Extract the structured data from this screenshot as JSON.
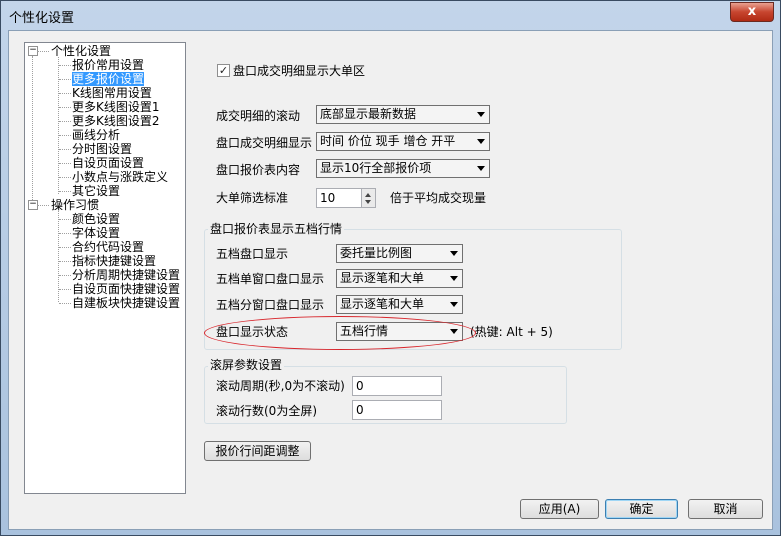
{
  "window": {
    "title": "个性化设置",
    "close_label": "x"
  },
  "tree": {
    "groups": [
      {
        "label": "个性化设置",
        "expander": "−",
        "children": [
          "报价常用设置",
          "更多报价设置",
          "K线图常用设置",
          "更多K线图设置1",
          "更多K线图设置2",
          "画线分析",
          "分时图设置",
          "自设页面设置",
          "小数点与涨跌定义",
          "其它设置"
        ]
      },
      {
        "label": "操作习惯",
        "expander": "−",
        "children": [
          "颜色设置",
          "字体设置",
          "合约代码设置",
          "指标快捷键设置",
          "分析周期快捷键设置",
          "自设页面快捷键设置",
          "自建板块快捷键设置"
        ]
      }
    ],
    "selected": "更多报价设置"
  },
  "settings": {
    "big_order_checkbox": {
      "label": "盘口成交明细显示大单区",
      "checked": true,
      "mark": "✓"
    },
    "scroll": {
      "label": "成交明细的滚动",
      "value": "底部显示最新数据"
    },
    "detail_display": {
      "label": "盘口成交明细显示",
      "value": "时间 价位 现手 增仓 开平"
    },
    "quote_content": {
      "label": "盘口报价表内容",
      "value": "显示10行全部报价项"
    },
    "big_filter": {
      "label": "大单筛选标准",
      "value": "10",
      "suffix": "倍于平均成交现量"
    }
  },
  "five_level": {
    "title": "盘口报价表显示五档行情",
    "display": {
      "label": "五档盘口显示",
      "value": "委托量比例图"
    },
    "single": {
      "label": "五档单窗口盘口显示",
      "value": "显示逐笔和大单"
    },
    "split": {
      "label": "五档分窗口盘口显示",
      "value": "显示逐笔和大单"
    },
    "status": {
      "label": "盘口显示状态",
      "value": "五档行情",
      "hotkey": "(热键:  Alt + 5)"
    }
  },
  "scroll_params": {
    "title": "滚屏参数设置",
    "period": {
      "label": "滚动周期(秒,0为不滚动)",
      "value": "0"
    },
    "rows": {
      "label": "滚动行数(0为全屏)",
      "value": "0"
    }
  },
  "row_spacing_button": "报价行间距调整",
  "buttons": {
    "apply": "应用(A)",
    "ok": "确定",
    "cancel": "取消"
  },
  "colors": {
    "selection": "#3399ff",
    "annotation": "#d8262c"
  }
}
